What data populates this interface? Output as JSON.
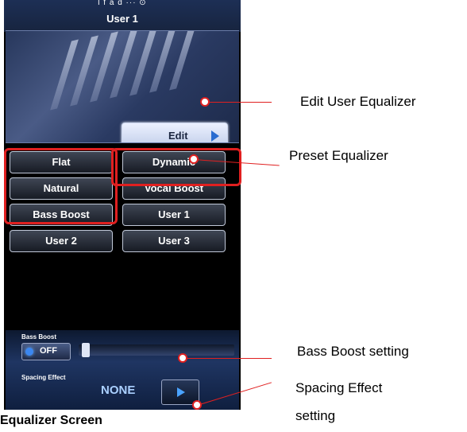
{
  "screen": {
    "status_text": "l  f   a   d   ···  ⊙",
    "title": "User 1",
    "edit_label": "Edit",
    "presets": [
      "Flat",
      "Dynamic",
      "Natural",
      "Vocal Boost",
      "Bass Boost",
      "User 1",
      "User 2",
      "User 3"
    ],
    "bass_boost": {
      "label": "Bass Boost",
      "toggle": "OFF",
      "level": 0.0
    },
    "spacing_effect": {
      "label": "Spacing Effect",
      "value": "NONE"
    }
  },
  "caption": "Equalizer Screen",
  "callouts": {
    "edit": "Edit User Equalizer",
    "preset": "Preset Equalizer",
    "bass": "Bass Boost setting",
    "spacing_line1": "Spacing Effect",
    "spacing_line2": "setting"
  },
  "colors": {
    "highlight": "#e02020",
    "accent": "#3b87f0"
  }
}
